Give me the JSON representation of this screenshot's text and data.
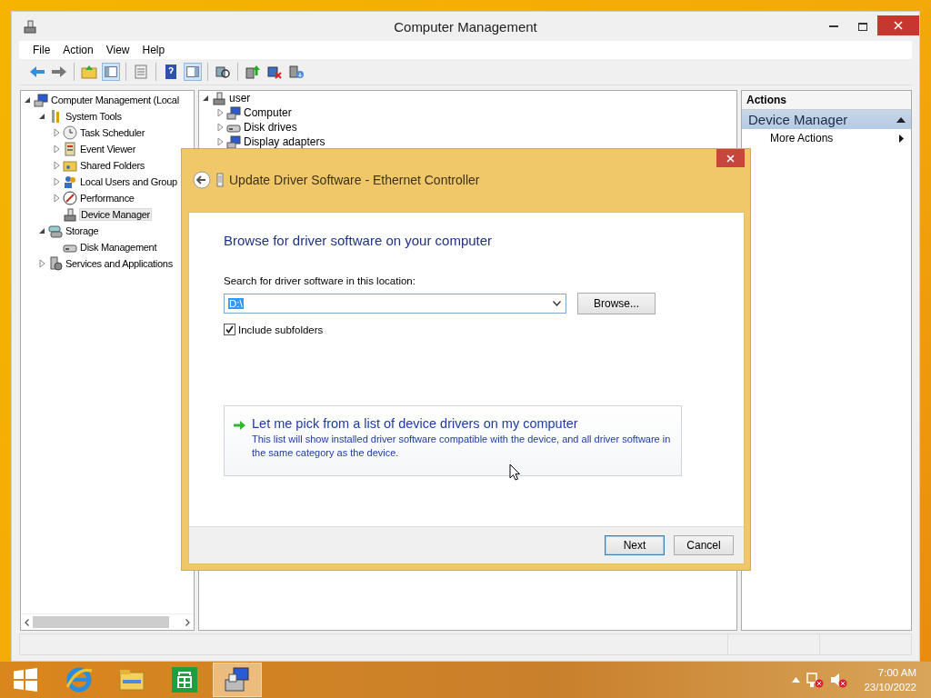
{
  "window": {
    "title": "Computer Management"
  },
  "menu": [
    "File",
    "Action",
    "View",
    "Help"
  ],
  "left_tree": [
    {
      "label": "Computer Management (Local",
      "kind": "computer",
      "expanded": true,
      "selected": false,
      "children": [
        {
          "label": "System Tools",
          "kind": "tools",
          "expanded": true,
          "selected": false,
          "children": [
            {
              "label": "Task Scheduler",
              "kind": "clock",
              "expanded": false,
              "selected": false
            },
            {
              "label": "Event Viewer",
              "kind": "log",
              "expanded": false,
              "selected": false
            },
            {
              "label": "Shared Folders",
              "kind": "folder",
              "expanded": false,
              "selected": false
            },
            {
              "label": "Local Users and Group",
              "kind": "users",
              "expanded": false,
              "selected": false
            },
            {
              "label": "Performance",
              "kind": "gauge",
              "expanded": false,
              "selected": false
            },
            {
              "label": "Device Manager",
              "kind": "device",
              "selected": true
            }
          ]
        },
        {
          "label": "Storage",
          "kind": "storage",
          "expanded": true,
          "selected": false,
          "children": [
            {
              "label": "Disk Management",
              "kind": "disk",
              "selected": false
            }
          ]
        },
        {
          "label": "Services and Applications",
          "kind": "services",
          "expanded": false,
          "selected": false
        }
      ]
    }
  ],
  "middle_tree": [
    {
      "label": "user",
      "kind": "device",
      "expanded": true,
      "selected": false,
      "children": [
        {
          "label": "Computer",
          "kind": "computer",
          "expanded": false,
          "selected": false
        },
        {
          "label": "Disk drives",
          "kind": "disk",
          "expanded": false,
          "selected": false
        },
        {
          "label": "Display adapters",
          "kind": "computer",
          "expanded": false,
          "selected": false
        }
      ]
    }
  ],
  "actions": {
    "header": "Actions",
    "section": {
      "label": "Device Manager",
      "expanded": true
    },
    "items": [
      "More Actions"
    ]
  },
  "dialog": {
    "title": "Update Driver Software - Ethernet Controller",
    "heading": "Browse for driver software on your computer",
    "location_label": "Search for driver software in this location:",
    "location_field": {
      "value": "D:\\"
    },
    "browse_button": "Browse...",
    "include_subfolders": {
      "label": "Include subfolders",
      "checked": true
    },
    "option": {
      "title": "Let me pick from a list of device drivers on my computer",
      "description": "This list will show installed driver software compatible with the device, and all driver software in the same category as the device."
    },
    "buttons": [
      {
        "label": "Next",
        "default": true
      },
      {
        "label": "Cancel",
        "default": false
      }
    ]
  },
  "taskbar": {
    "apps": [
      {
        "kind": "ie",
        "selected": false
      },
      {
        "kind": "explorer",
        "selected": false
      },
      {
        "kind": "store",
        "selected": false
      },
      {
        "kind": "manage",
        "selected": true
      }
    ],
    "time": "7:00 AM",
    "date": "23/10/2022"
  }
}
